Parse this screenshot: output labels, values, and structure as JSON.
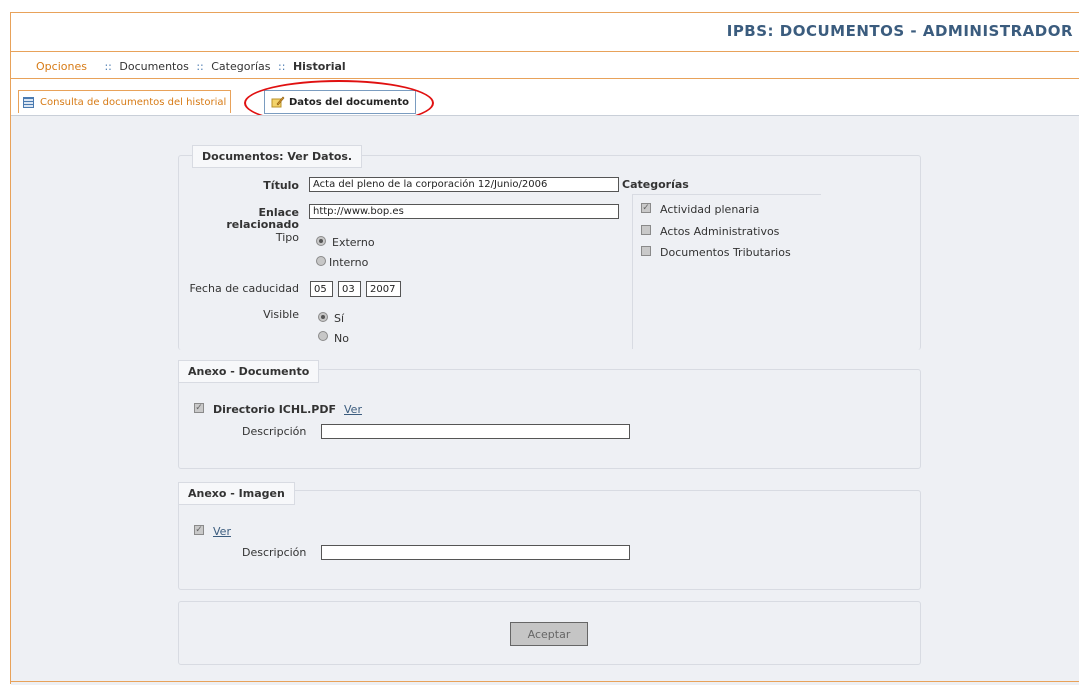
{
  "header": {
    "title": "IPBS: DOCUMENTOS - ADMINISTRADOR"
  },
  "menu": {
    "options_label": "Opciones",
    "sep": "::",
    "items": [
      "Documentos",
      "Categorías",
      "Historial"
    ]
  },
  "tabs": [
    {
      "label": "Consulta de documentos del historial",
      "icon": "table-icon"
    },
    {
      "label": "Datos del documento",
      "icon": "pencil-icon"
    }
  ],
  "form": {
    "legend": "Documentos: Ver Datos.",
    "titulo_label": "Título",
    "titulo_value": "Acta del pleno de la corporación 12/Junio/2006",
    "enlace_label_1": "Enlace",
    "enlace_label_2": "relacionado",
    "enlace_value": "http://www.bop.es",
    "tipo_label": "Tipo",
    "tipo_options": [
      "Externo",
      "Interno"
    ],
    "tipo_selected": "Externo",
    "fecha_label": "Fecha de caducidad",
    "fecha_day": "05",
    "fecha_month": "03",
    "fecha_year": "2007",
    "visible_label": "Visible",
    "visible_options": [
      "Sí",
      "No"
    ],
    "visible_selected": "Sí",
    "categorias_label": "Categorías",
    "categorias": [
      {
        "label": "Actividad plenaria",
        "checked": true
      },
      {
        "label": "Actos Administrativos",
        "checked": false
      },
      {
        "label": "Documentos Tributarios",
        "checked": false
      }
    ]
  },
  "anexo_documento": {
    "legend": "Anexo - Documento",
    "file_label": "Directorio ICHL.PDF",
    "ver_link": "Ver",
    "descripcion_label": "Descripción",
    "descripcion_value": ""
  },
  "anexo_imagen": {
    "legend": "Anexo - Imagen",
    "ver_link": "Ver",
    "descripcion_label": "Descripción",
    "descripcion_value": ""
  },
  "actions": {
    "accept_label": "Aceptar"
  },
  "colors": {
    "accent_orange": "#d77b16",
    "title_blue": "#3b5c7e",
    "annotation_red": "#e01010"
  }
}
